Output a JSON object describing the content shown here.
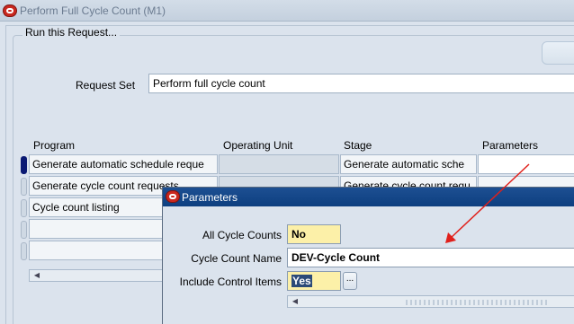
{
  "window": {
    "title": "Perform Full Cycle Count (M1)"
  },
  "group": {
    "legend": "Run this Request..."
  },
  "request_set": {
    "label": "Request Set",
    "value": "Perform full cycle count"
  },
  "table": {
    "headers": {
      "program": "Program",
      "operating_unit": "Operating Unit",
      "stage": "Stage",
      "parameters": "Parameters"
    },
    "rows": [
      {
        "program": "Generate automatic schedule reque",
        "operating_unit": "",
        "stage": "Generate automatic sche",
        "parameters": ""
      },
      {
        "program": "Generate cycle count requests",
        "operating_unit": "",
        "stage": "Generate cycle count requ",
        "parameters": ""
      },
      {
        "program": "Cycle count listing",
        "operating_unit": "",
        "stage": "",
        "parameters": ""
      },
      {
        "program": "",
        "operating_unit": "",
        "stage": "",
        "parameters": ""
      },
      {
        "program": "",
        "operating_unit": "",
        "stage": "",
        "parameters": ""
      }
    ]
  },
  "dialog": {
    "title": "Parameters",
    "fields": {
      "all_cycle_counts": {
        "label": "All Cycle Counts",
        "value": "No"
      },
      "cycle_count_name": {
        "label": "Cycle Count Name",
        "value": "DEV-Cycle Count"
      },
      "include_control_items": {
        "label": "Include Control Items",
        "value": "Yes"
      }
    },
    "lov_button": "..."
  },
  "annotation": {
    "arrow_color": "#e0201b"
  },
  "colors": {
    "dialog_titlebar": "#0d3f80",
    "highlight_field": "#fcf0a8",
    "current_record": "#0b1a73"
  }
}
